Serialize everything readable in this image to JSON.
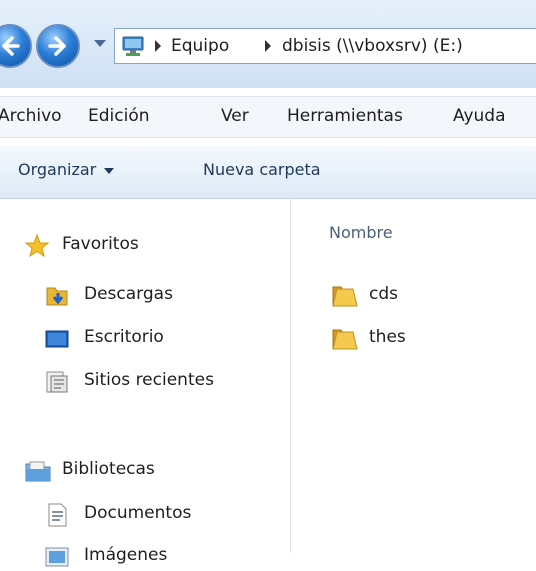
{
  "address_bar": {
    "breadcrumbs": [
      "Equipo",
      "dbisis (\\\\vboxsrv) (E:)"
    ]
  },
  "menu": [
    "Archivo",
    "Edición",
    "Ver",
    "Herramientas",
    "Ayuda"
  ],
  "toolbar": {
    "organize_label": "Organizar",
    "new_folder_label": "Nueva carpeta"
  },
  "nav_pane": {
    "favorites": {
      "label": "Favoritos",
      "items": [
        "Descargas",
        "Escritorio",
        "Sitios recientes"
      ]
    },
    "libraries": {
      "label": "Bibliotecas",
      "items": [
        "Documentos",
        "Imágenes"
      ]
    }
  },
  "content": {
    "column_header": "Nombre",
    "files": [
      {
        "name": "cds",
        "type": "folder"
      },
      {
        "name": "thes",
        "type": "folder"
      }
    ]
  },
  "colors": {
    "folder": "#e8b634",
    "accent": "#2d7fd8"
  }
}
